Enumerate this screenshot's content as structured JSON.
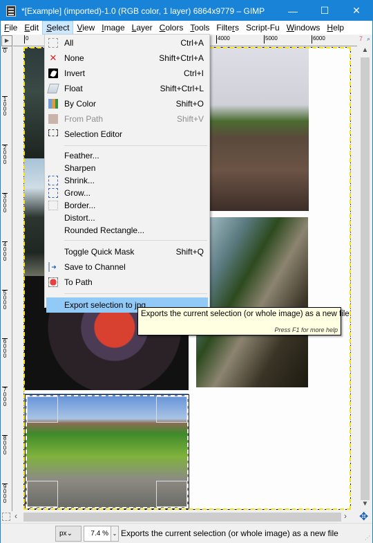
{
  "window": {
    "title": "*[Example] (imported)-1.0 (RGB color, 1 layer) 6864x9779 – GIMP",
    "controls": {
      "minimize": "—",
      "maximize": "☐",
      "close": "✕"
    }
  },
  "menubar": {
    "items": [
      {
        "label": "File",
        "mnemonic": "F"
      },
      {
        "label": "Edit",
        "mnemonic": "E"
      },
      {
        "label": "Select",
        "mnemonic": "S",
        "active": true
      },
      {
        "label": "View",
        "mnemonic": "V"
      },
      {
        "label": "Image",
        "mnemonic": "I"
      },
      {
        "label": "Layer",
        "mnemonic": "L"
      },
      {
        "label": "Colors",
        "mnemonic": "C"
      },
      {
        "label": "Tools",
        "mnemonic": "T"
      },
      {
        "label": "Filters",
        "mnemonic": "r"
      },
      {
        "label": "Script-Fu",
        "mnemonic": ""
      },
      {
        "label": "Windows",
        "mnemonic": "W"
      },
      {
        "label": "Help",
        "mnemonic": "H"
      }
    ]
  },
  "rulers": {
    "horizontal_labels": [
      "0",
      "4000",
      "5000",
      "6000",
      "7"
    ],
    "vertical_labels": [
      "0",
      "1000",
      "2000",
      "3000",
      "4000",
      "5000",
      "6000",
      "7000",
      "8000",
      "9000"
    ]
  },
  "select_menu": {
    "groups": [
      [
        {
          "label": "All",
          "shortcut": "Ctrl+A",
          "icon": "select-all-icon"
        },
        {
          "label": "None",
          "shortcut": "Shift+Ctrl+A",
          "icon": "select-none-icon"
        },
        {
          "label": "Invert",
          "shortcut": "Ctrl+I",
          "icon": "invert-icon"
        },
        {
          "label": "Float",
          "shortcut": "Shift+Ctrl+L",
          "icon": "float-icon"
        },
        {
          "label": "By Color",
          "shortcut": "Shift+O",
          "icon": "by-color-icon"
        },
        {
          "label": "From Path",
          "shortcut": "Shift+V",
          "icon": "from-path-icon",
          "disabled": true
        },
        {
          "label": "Selection Editor",
          "shortcut": "",
          "icon": "selection-editor-icon"
        }
      ],
      [
        {
          "label": "Feather...",
          "shortcut": "",
          "icon": ""
        },
        {
          "label": "Sharpen",
          "shortcut": "",
          "icon": ""
        },
        {
          "label": "Shrink...",
          "shortcut": "",
          "icon": "shrink-icon"
        },
        {
          "label": "Grow...",
          "shortcut": "",
          "icon": "grow-icon"
        },
        {
          "label": "Border...",
          "shortcut": "",
          "icon": "border-icon"
        },
        {
          "label": "Distort...",
          "shortcut": "",
          "icon": ""
        },
        {
          "label": "Rounded Rectangle...",
          "shortcut": "",
          "icon": ""
        }
      ],
      [
        {
          "label": "Toggle Quick Mask",
          "shortcut": "Shift+Q",
          "icon": ""
        },
        {
          "label": "Save to Channel",
          "shortcut": "",
          "icon": "save-to-channel-icon"
        },
        {
          "label": "To Path",
          "shortcut": "",
          "icon": "to-path-icon"
        }
      ],
      [
        {
          "label": "Export selection to jpg",
          "shortcut": "",
          "icon": "",
          "highlighted": true
        }
      ]
    ]
  },
  "tooltip": {
    "text": "Exports the current selection (or whole image) as a new file",
    "help": "Press F1 for more help"
  },
  "statusbar": {
    "unit": "px",
    "zoom": "7.4 %",
    "message": "Exports the current selection (or whole image) as a new file"
  },
  "colors": {
    "titlebar": "#1883d7",
    "menu_highlight": "#91c9f7",
    "selection_marching_ants": "#f5e31a",
    "tooltip_bg": "#ffffe1"
  }
}
